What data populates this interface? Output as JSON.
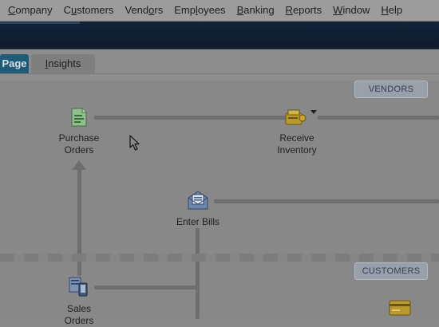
{
  "menu": {
    "items": [
      {
        "pre": "",
        "ul": "C",
        "post": "ompany"
      },
      {
        "pre": "C",
        "ul": "u",
        "post": "stomers"
      },
      {
        "pre": "Vend",
        "ul": "o",
        "post": "rs"
      },
      {
        "pre": "Emp",
        "ul": "l",
        "post": "oyees"
      },
      {
        "pre": "",
        "ul": "B",
        "post": "anking"
      },
      {
        "pre": "",
        "ul": "R",
        "post": "eports"
      },
      {
        "pre": "",
        "ul": "W",
        "post": "indow"
      },
      {
        "pre": "",
        "ul": "H",
        "post": "elp"
      }
    ]
  },
  "tabs": {
    "active": "Page",
    "insights": {
      "pre": "",
      "ul": "I",
      "post": "nsights"
    }
  },
  "sections": {
    "vendors": "VENDORS",
    "customers": "CUSTOMERS"
  },
  "workflow": {
    "purchase_orders": "Purchase\nOrders",
    "receive_inventory": "Receive\nInventory",
    "enter_bills": "Enter Bills",
    "sales_orders": "Sales\nOrders"
  },
  "icons": {
    "purchase_orders": "purchase-order-icon",
    "receive_inventory": "receive-inventory-icon",
    "enter_bills": "enter-bills-icon",
    "sales_orders": "sales-orders-icon",
    "card": "credit-card-icon"
  }
}
